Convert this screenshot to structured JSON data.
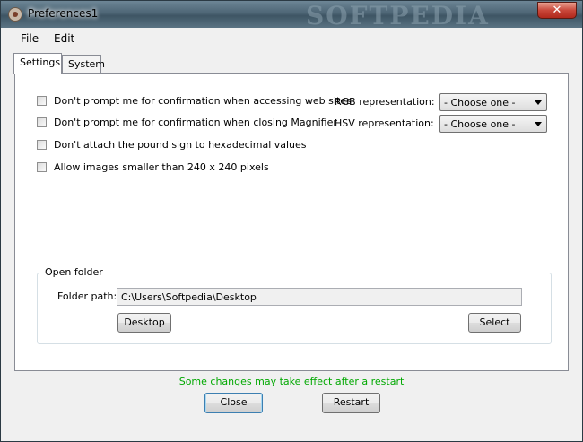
{
  "window": {
    "title": "Preferences1",
    "watermark": "SOFTPEDIA",
    "close_glyph": "✕"
  },
  "menu": [
    "File",
    "Edit"
  ],
  "tabs": [
    {
      "label": "Settings",
      "active": true
    },
    {
      "label": "System",
      "active": false
    }
  ],
  "settings": {
    "checkboxes": [
      {
        "label": "Don't prompt me for confirmation when accessing web sites",
        "checked": false
      },
      {
        "label": "Don't prompt me for confirmation when closing Magnifier",
        "checked": false
      },
      {
        "label": "Don't attach the pound sign to hexadecimal values",
        "checked": false
      },
      {
        "label": "Allow images smaller than 240 x 240 pixels",
        "checked": false
      }
    ],
    "rgb_label": "RGB representation:",
    "rgb_value": "- Choose one -",
    "hsv_label": "HSV representation:",
    "hsv_value": "- Choose one -"
  },
  "open_folder": {
    "title": "Open folder",
    "path_label": "Folder path:",
    "path_value": "C:\\Users\\Softpedia\\Desktop",
    "desktop_button": "Desktop",
    "select_button": "Select"
  },
  "footer": {
    "notice": "Some changes may take effect after a restart",
    "close_button": "Close",
    "restart_button": "Restart"
  },
  "colors": {
    "notice": "#00a800",
    "title_close": "#c9473a"
  }
}
